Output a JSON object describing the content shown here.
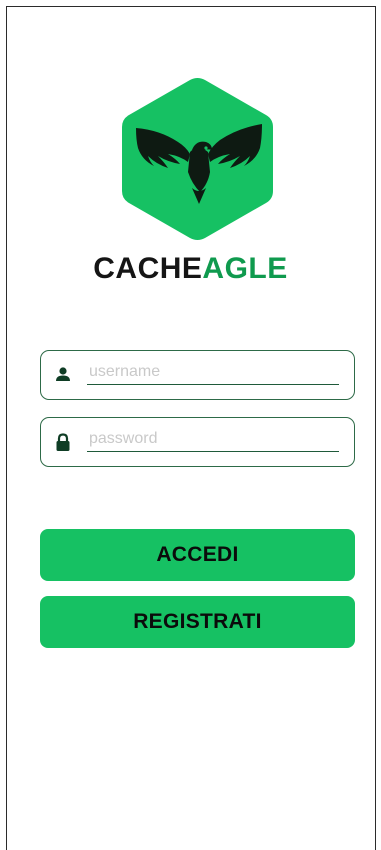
{
  "brand": {
    "name_part1": "CACHE",
    "name_part2": "AGLE",
    "color_dark": "#151515",
    "color_green": "#0f9a4e",
    "logo_color": "#16c163"
  },
  "login_form": {
    "username": {
      "value": "",
      "placeholder": "username",
      "icon": "user-icon"
    },
    "password": {
      "value": "",
      "placeholder": "password",
      "icon": "lock-icon"
    }
  },
  "actions": {
    "login_label": "ACCEDI",
    "register_label": "REGISTRATI",
    "button_color": "#16c163"
  }
}
